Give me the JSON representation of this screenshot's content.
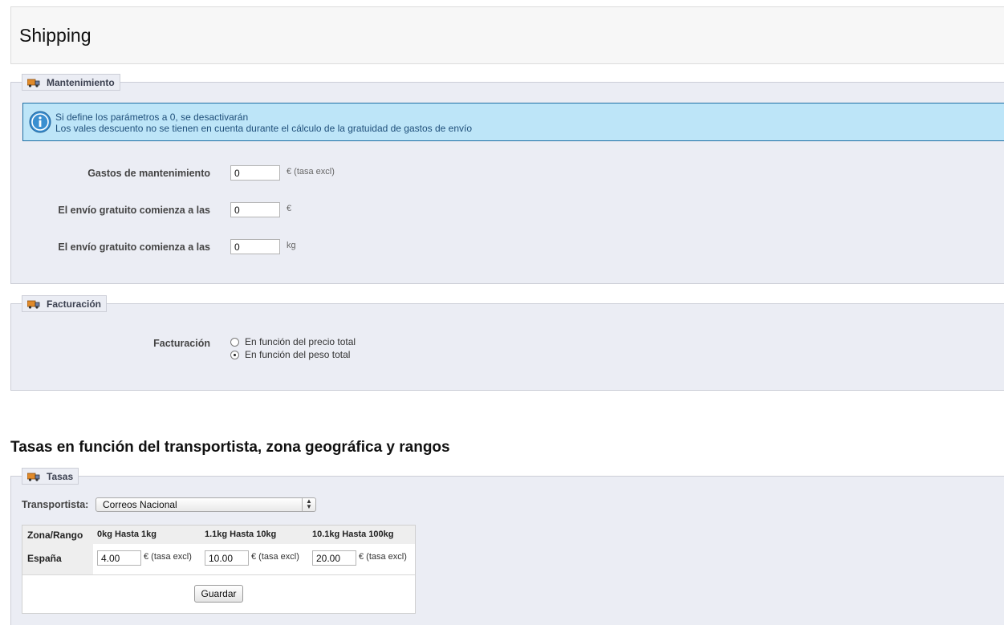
{
  "page": {
    "title": "Shipping"
  },
  "handling": {
    "legend": "Mantenimiento",
    "info_line1": "Si define los parámetros a 0, se desactivarán",
    "info_line2": "Los vales descuento no se tienen en cuenta durante el cálculo de la gratuidad de gastos de envío",
    "fields": [
      {
        "label": "Gastos de mantenimiento",
        "value": "0",
        "suffix": "€ (tasa excl)"
      },
      {
        "label": "El envío gratuito comienza a las",
        "value": "0",
        "suffix": "€"
      },
      {
        "label": "El envío gratuito comienza a las",
        "value": "0",
        "suffix": "kg"
      }
    ]
  },
  "billing": {
    "legend": "Facturación",
    "label": "Facturación",
    "options": [
      {
        "label": "En función del precio total",
        "selected": false
      },
      {
        "label": "En función del peso total",
        "selected": true
      }
    ]
  },
  "rates_section": {
    "title": "Tasas en función del transportista, zona geográfica y rangos"
  },
  "fees": {
    "legend": "Tasas",
    "carrier_label": "Transportista:",
    "carrier_selected": "Correos Nacional",
    "table": {
      "columns": [
        "Zona/Rango",
        "0kg Hasta 1kg",
        "1.1kg Hasta 10kg",
        "10.1kg Hasta 100kg"
      ],
      "rows": [
        {
          "zone": "España",
          "values": [
            "4.00",
            "10.00",
            "20.00"
          ],
          "suffix": "€ (tasa excl)"
        }
      ]
    },
    "save_label": "Guardar"
  },
  "icons": {
    "truck": "truck-icon",
    "info": "info-icon"
  },
  "colors": {
    "fieldset_bg": "#ebedf4",
    "info_bg": "#bde5f8",
    "info_border": "#1f6ea3"
  }
}
